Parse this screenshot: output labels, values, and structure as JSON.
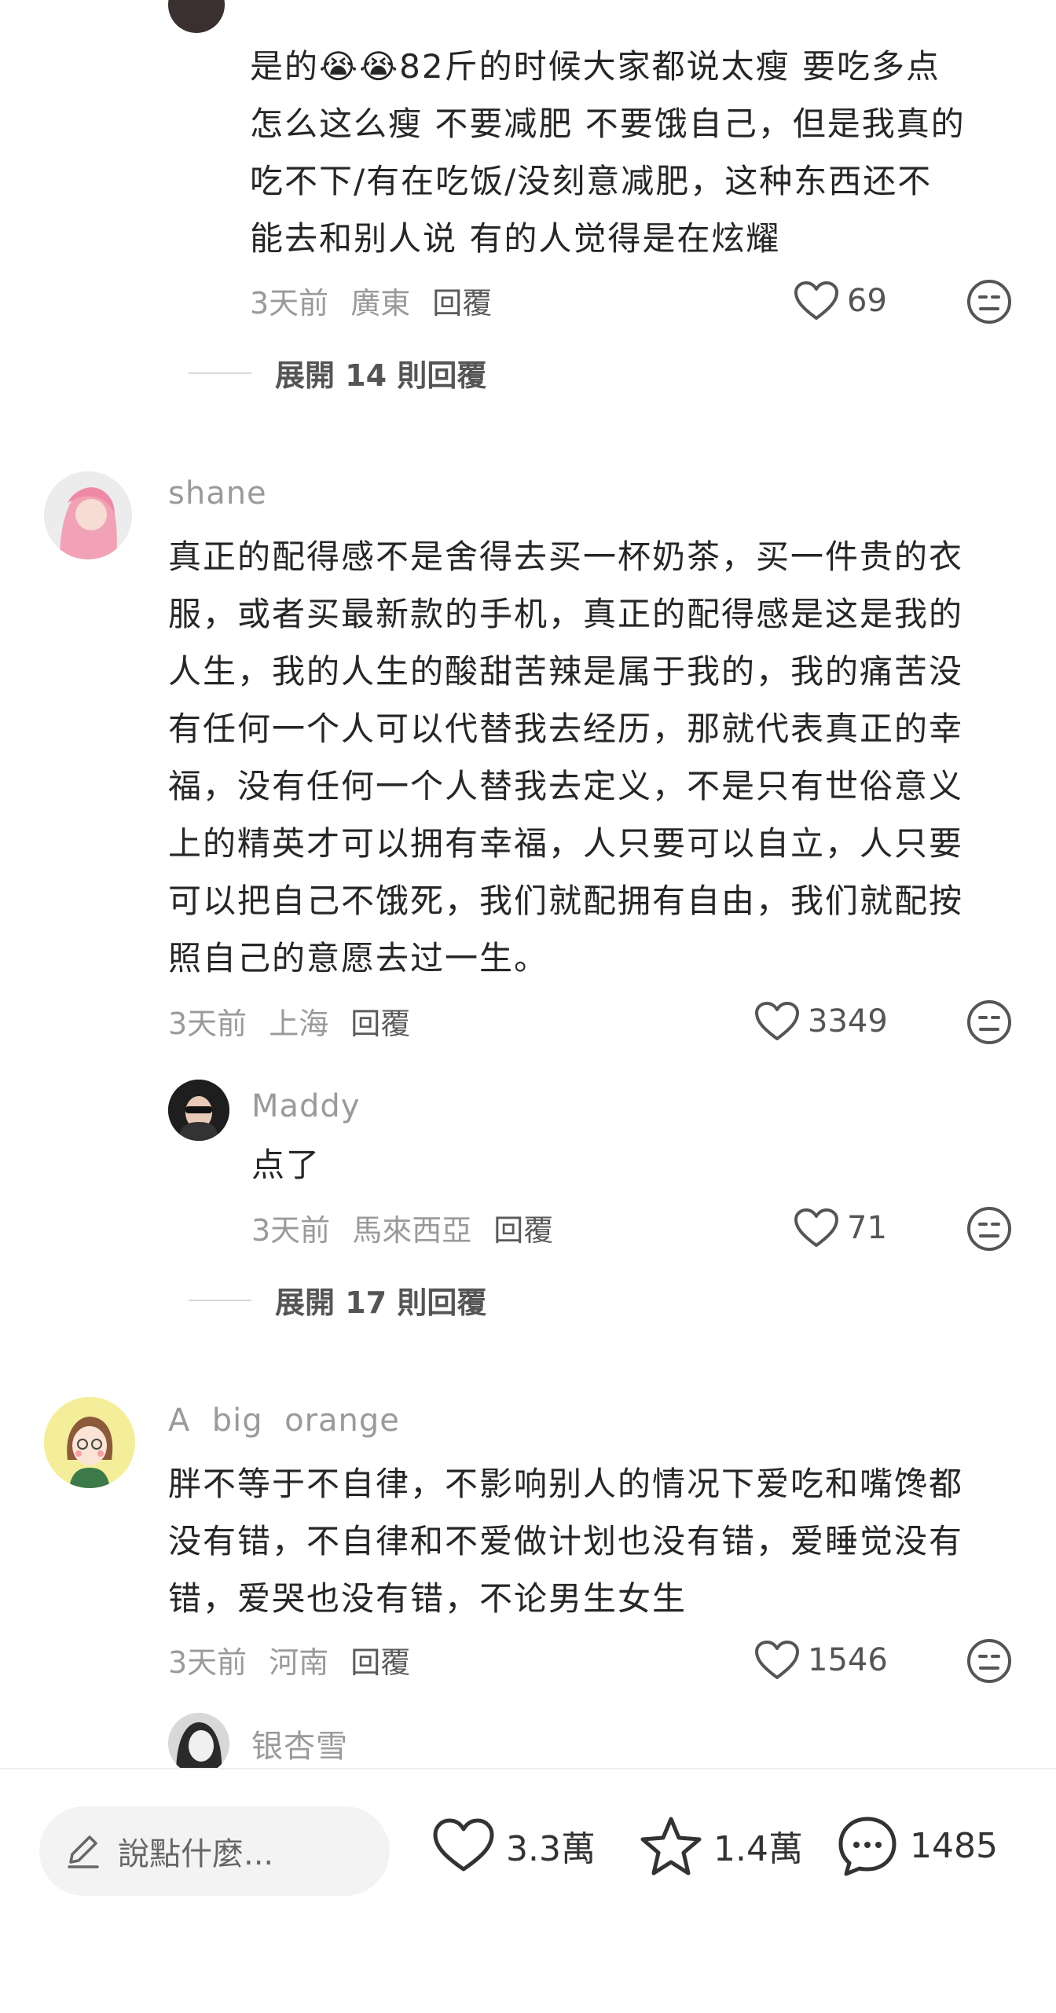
{
  "comments": [
    {
      "content_lines": [
        "是的😭😭82斤的时候大家都说太瘦 要吃多点",
        "怎么这么瘦 不要减肥 不要饿自己，但是我真的",
        "吃不下/有在吃饭/没刻意减肥，这种东西还不",
        "能去和别人说 有的人觉得是在炫耀"
      ],
      "time": "3天前",
      "location": "廣東",
      "reply_label": "回覆",
      "likes": "69",
      "expand_label": "展開 14 則回覆"
    },
    {
      "username": "shane",
      "content_lines": [
        "真正的配得感不是舍得去买一杯奶茶，买一件贵的衣",
        "服，或者买最新款的手机，真正的配得感是这是我的",
        "人生，我的人生的酸甜苦辣是属于我的，我的痛苦没",
        "有任何一个人可以代替我去经历，那就代表真正的幸",
        "福，没有任何一个人替我去定义，不是只有世俗意义",
        "上的精英才可以拥有幸福，人只要可以自立，人只要",
        "可以把自己不饿死，我们就配拥有自由，我们就配按",
        "照自己的意愿去过一生。"
      ],
      "time": "3天前",
      "location": "上海",
      "reply_label": "回覆",
      "likes": "3349"
    },
    {
      "username": "Maddy",
      "content_lines": [
        "点了"
      ],
      "time": "3天前",
      "location": "馬來西亞",
      "reply_label": "回覆",
      "likes": "71",
      "expand_label": "展開 17 則回覆"
    },
    {
      "username": "A  big  orange",
      "content_lines": [
        "胖不等于不自律，不影响别人的情况下爱吃和嘴馋都",
        "没有错，不自律和不爱做计划也没有错，爱睡觉没有",
        "错，爱哭也没有错，不论男生女生"
      ],
      "time": "3天前",
      "location": "河南",
      "reply_label": "回覆",
      "likes": "1546"
    },
    {
      "username": "银杏雪"
    }
  ],
  "bottom_bar": {
    "input_placeholder": "說點什麼...",
    "likes": "3.3萬",
    "favorites": "1.4萬",
    "comments": "1485"
  },
  "icons": {
    "like": "heart-icon",
    "dislike": "neutral-face-icon",
    "edit": "pencil-icon",
    "favorite": "star-icon",
    "comment": "chat-bubble-icon"
  },
  "colors": {
    "text": "#262626",
    "meta": "#9a9a9a",
    "background": "#ffffff"
  }
}
